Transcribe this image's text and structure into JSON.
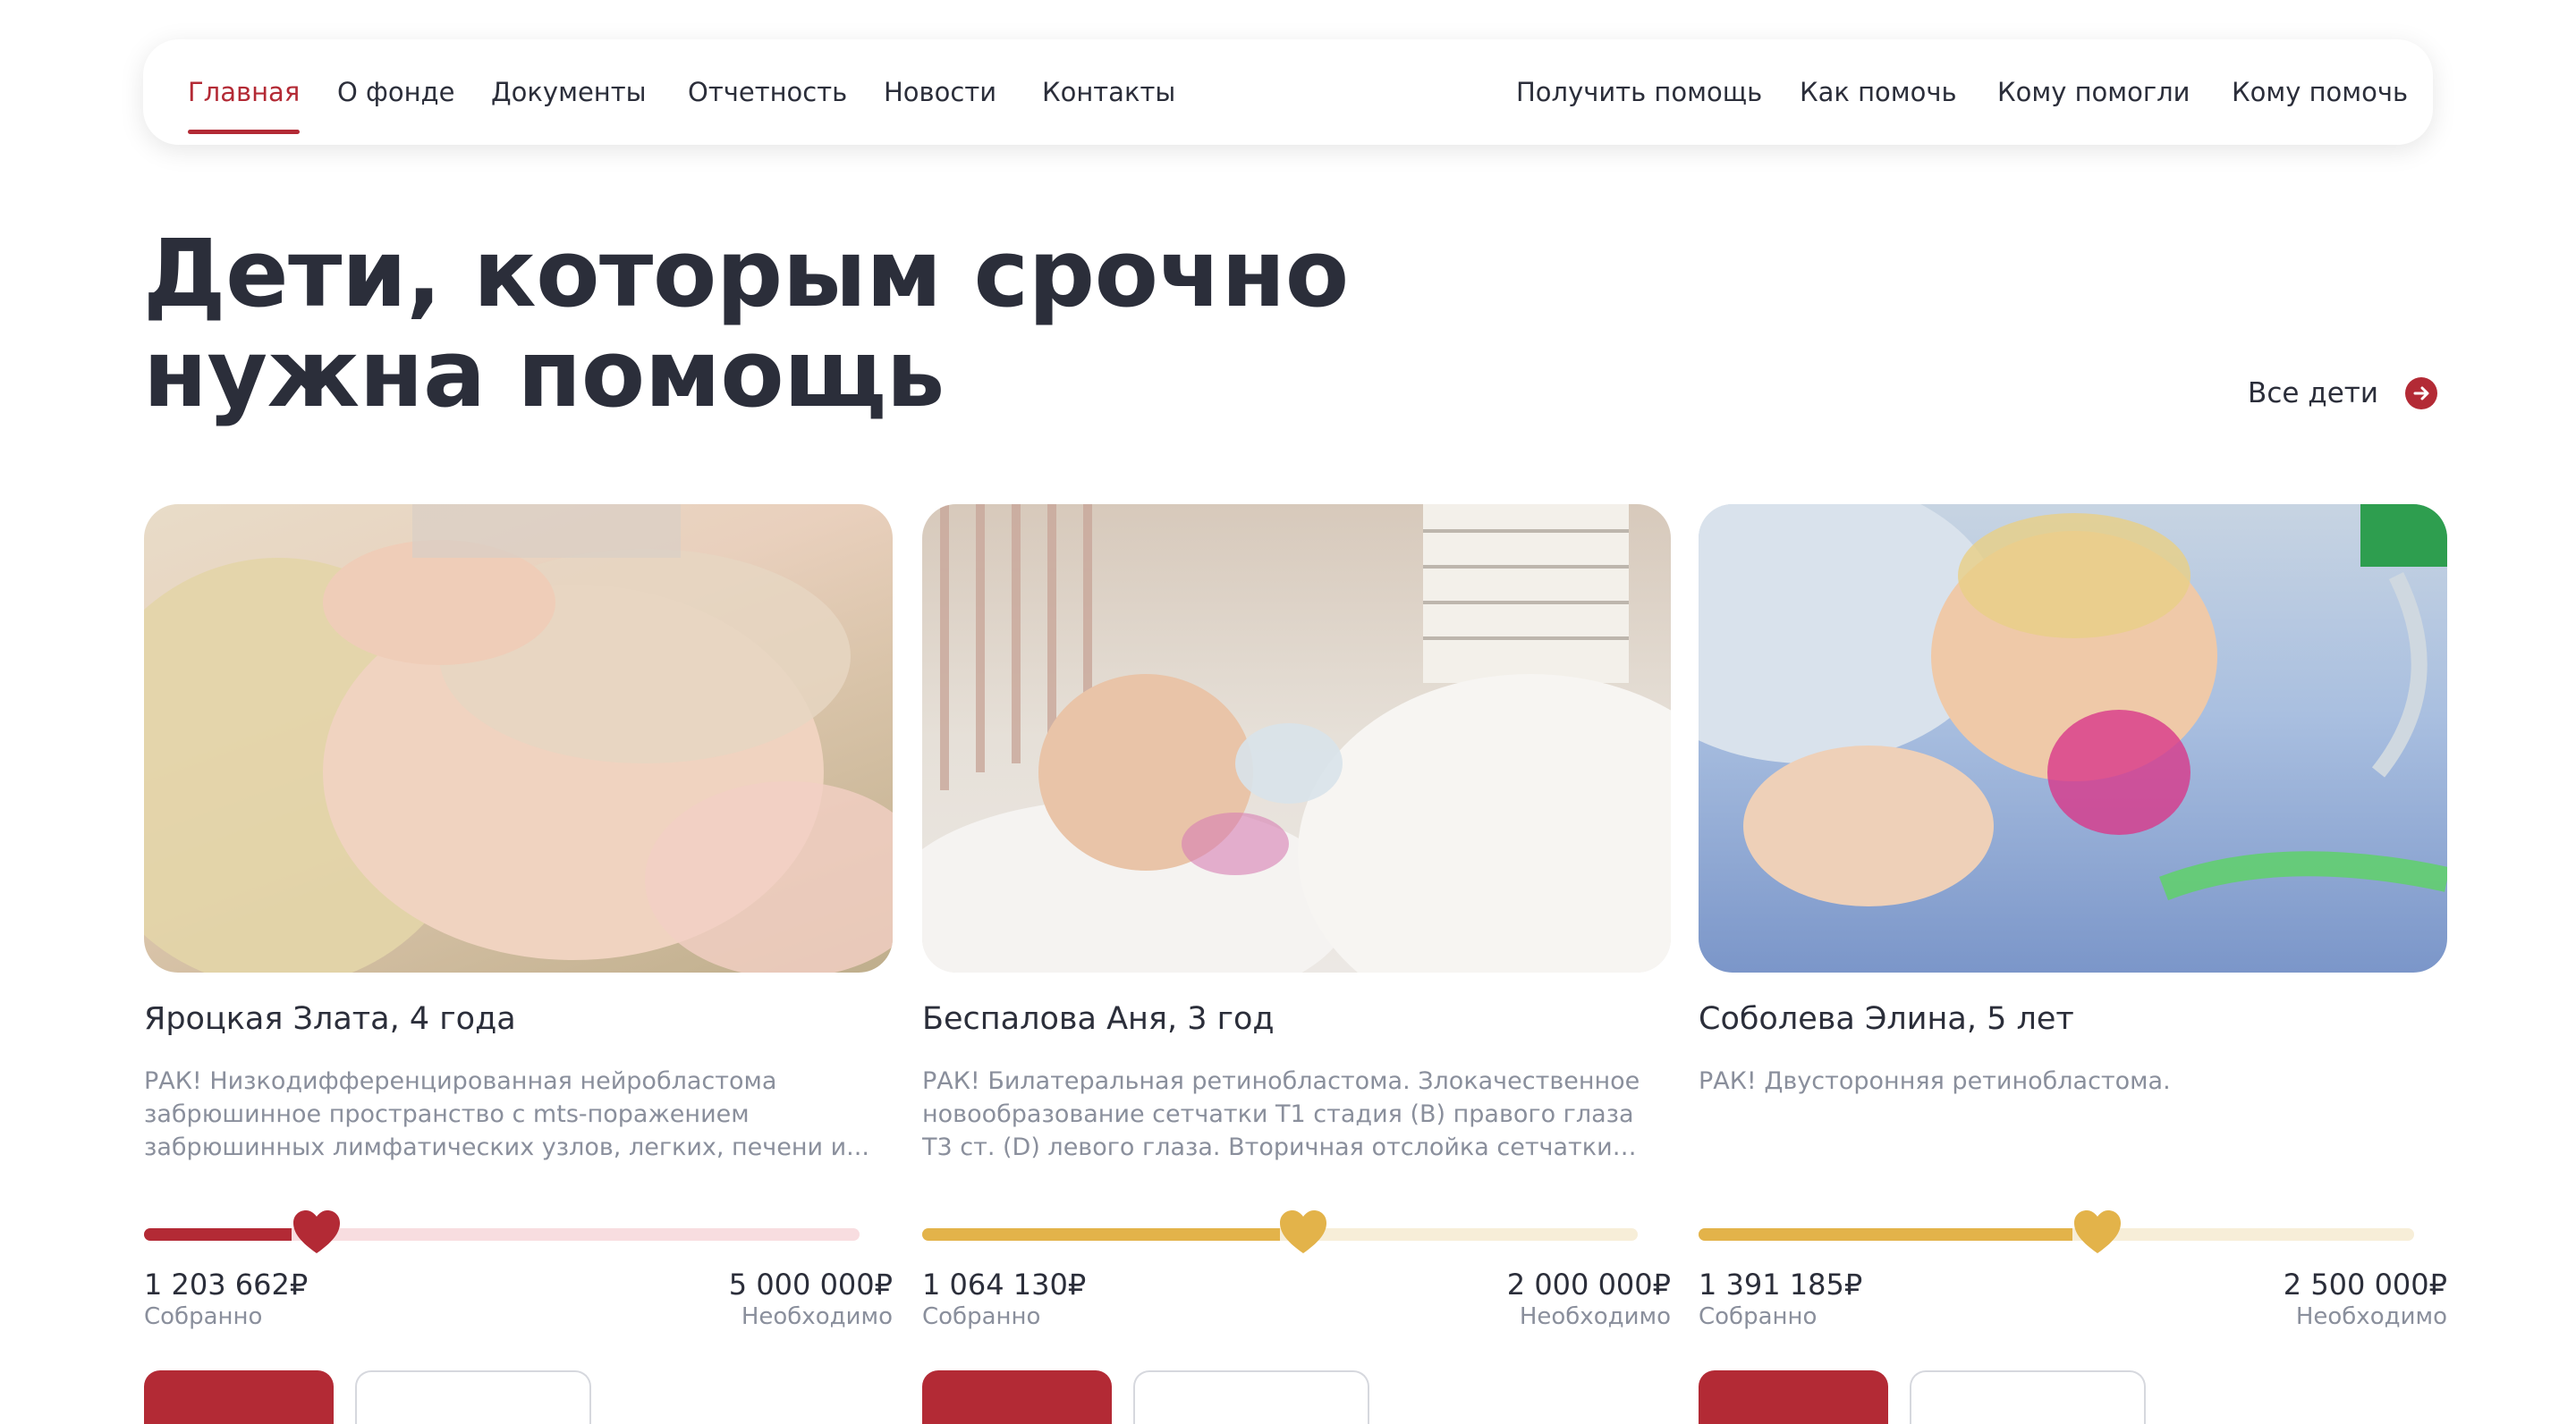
{
  "nav": {
    "left": [
      "Главная",
      "О фонде",
      "Документы",
      "Отчетность",
      "Новости",
      "Контакты"
    ],
    "right": [
      "Получить помощь",
      "Как помочь",
      "Кому помогли",
      "Кому помочь"
    ],
    "active": "Главная"
  },
  "hero": {
    "title_line1": "Дети, которым срочно",
    "title_line2": "нужна помощь",
    "all_children_label": "Все дети"
  },
  "cards": [
    {
      "name": "Яроцкая Злата, 4 года",
      "description": "РАК! Низкодифференцированная нейробластома забрюшинное пространство с mts-поражением забрюшинных лимфатических узлов, легких, печени и...",
      "collected": "1 203 662₽",
      "collected_label": "Собранно",
      "needed": "5 000 000₽",
      "needed_label": "Необходимо",
      "progress": 0.24,
      "accent": "#b32a35",
      "track": "#f8dde0"
    },
    {
      "name": "Беспалова Аня, 3 год",
      "description": "РАК! Билатеральная ретинобластома. Злокачественное новообразование сетчатки Т1 стадия (В) правого глаза Т3 ст. (D) левого глаза. Вторичная отслойка сетчатки левого...",
      "collected": "1 064 130₽",
      "collected_label": "Собранно",
      "needed": "2 000 000₽",
      "needed_label": "Необходимо",
      "progress": 0.53,
      "accent": "#e3b34a",
      "track": "#f7eed8"
    },
    {
      "name": "Соболева Элина, 5 лет",
      "description": "РАК! Двусторонняя ретинобластома.",
      "collected": "1 391 185₽",
      "collected_label": "Собранно",
      "needed": "2 500 000₽",
      "needed_label": "Необходимо",
      "progress": 0.56,
      "accent": "#e3b34a",
      "track": "#f7eed8"
    }
  ]
}
